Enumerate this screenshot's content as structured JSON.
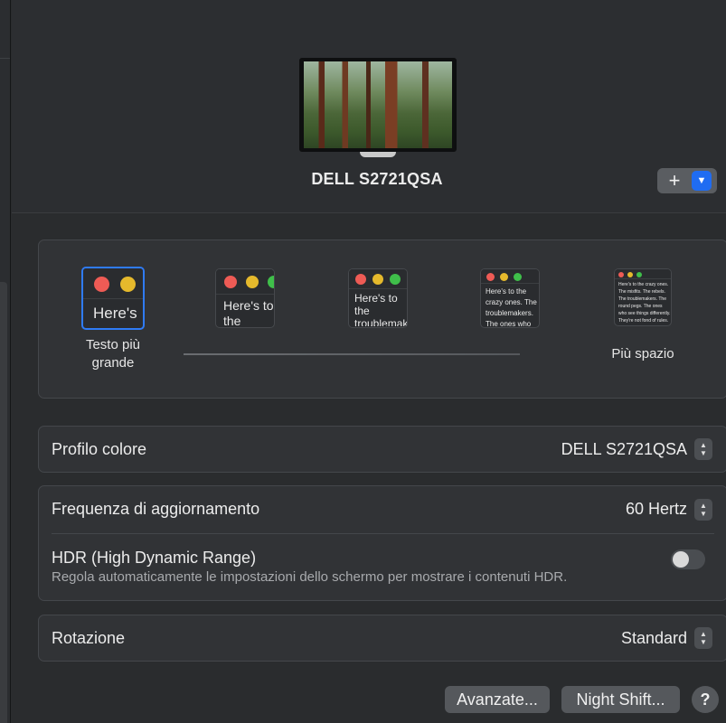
{
  "display": {
    "name": "DELL S2721QSA"
  },
  "toolbar": {
    "add_label": "+",
    "dropdown_label": "⌄"
  },
  "resolution": {
    "options": [
      {
        "preview_text": "Here's"
      },
      {
        "preview_text": "Here's to the troublemakers"
      },
      {
        "preview_text": "Here's to the troublemakers. The ones who"
      },
      {
        "preview_text": "Here's to the crazy ones. The troublemakers. The ones who see things differently. They're not fond of rules. And they"
      },
      {
        "preview_text": "Here's to the crazy ones. The misfits. The rebels. The troublemakers. The round pegs. The ones who see things differently. They're not fond of rules. And they have no respect. You can quote them, disagree with them. About the only thing you can't do is ignore them. Because they change things."
      }
    ],
    "label_larger_line1": "Testo più",
    "label_larger_line2": "grande",
    "label_more_space": "Più spazio",
    "selected_index": 0
  },
  "color_profile": {
    "label": "Profilo colore",
    "value": "DELL S2721QSA"
  },
  "refresh_rate": {
    "label": "Frequenza di aggiornamento",
    "value": "60 Hertz"
  },
  "hdr": {
    "label": "HDR (High Dynamic Range)",
    "description": "Regola automaticamente le impostazioni dello schermo per mostrare i contenuti HDR.",
    "enabled": false
  },
  "rotation": {
    "label": "Rotazione",
    "value": "Standard"
  },
  "buttons": {
    "advanced": "Avanzate...",
    "night_shift": "Night Shift...",
    "help": "?"
  },
  "colors": {
    "accent": "#2f7bf5",
    "traffic_red": "#ee5b55",
    "traffic_yellow": "#e5b92c",
    "traffic_green": "#3fbf4a"
  }
}
